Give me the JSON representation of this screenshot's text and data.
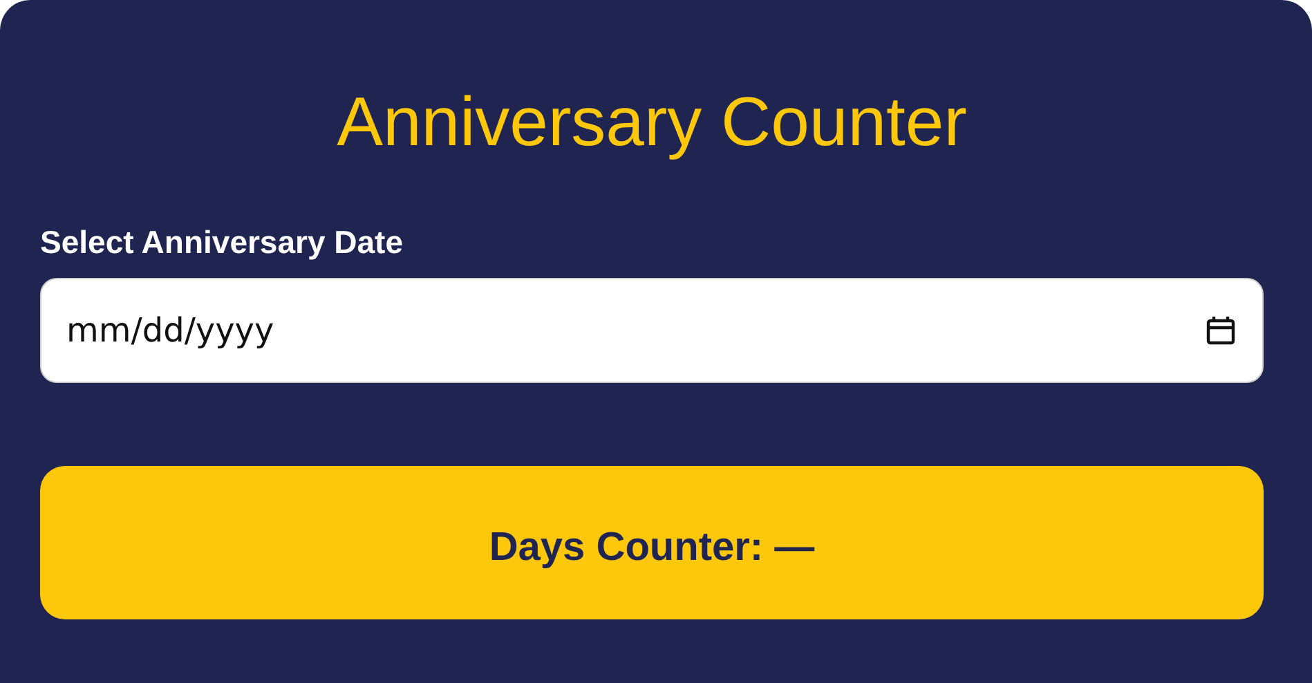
{
  "title": "Anniversary Counter",
  "date_field": {
    "label": "Select Anniversary Date",
    "placeholder": "mm/dd/yyyy"
  },
  "result": {
    "text": "Days Counter: —"
  }
}
